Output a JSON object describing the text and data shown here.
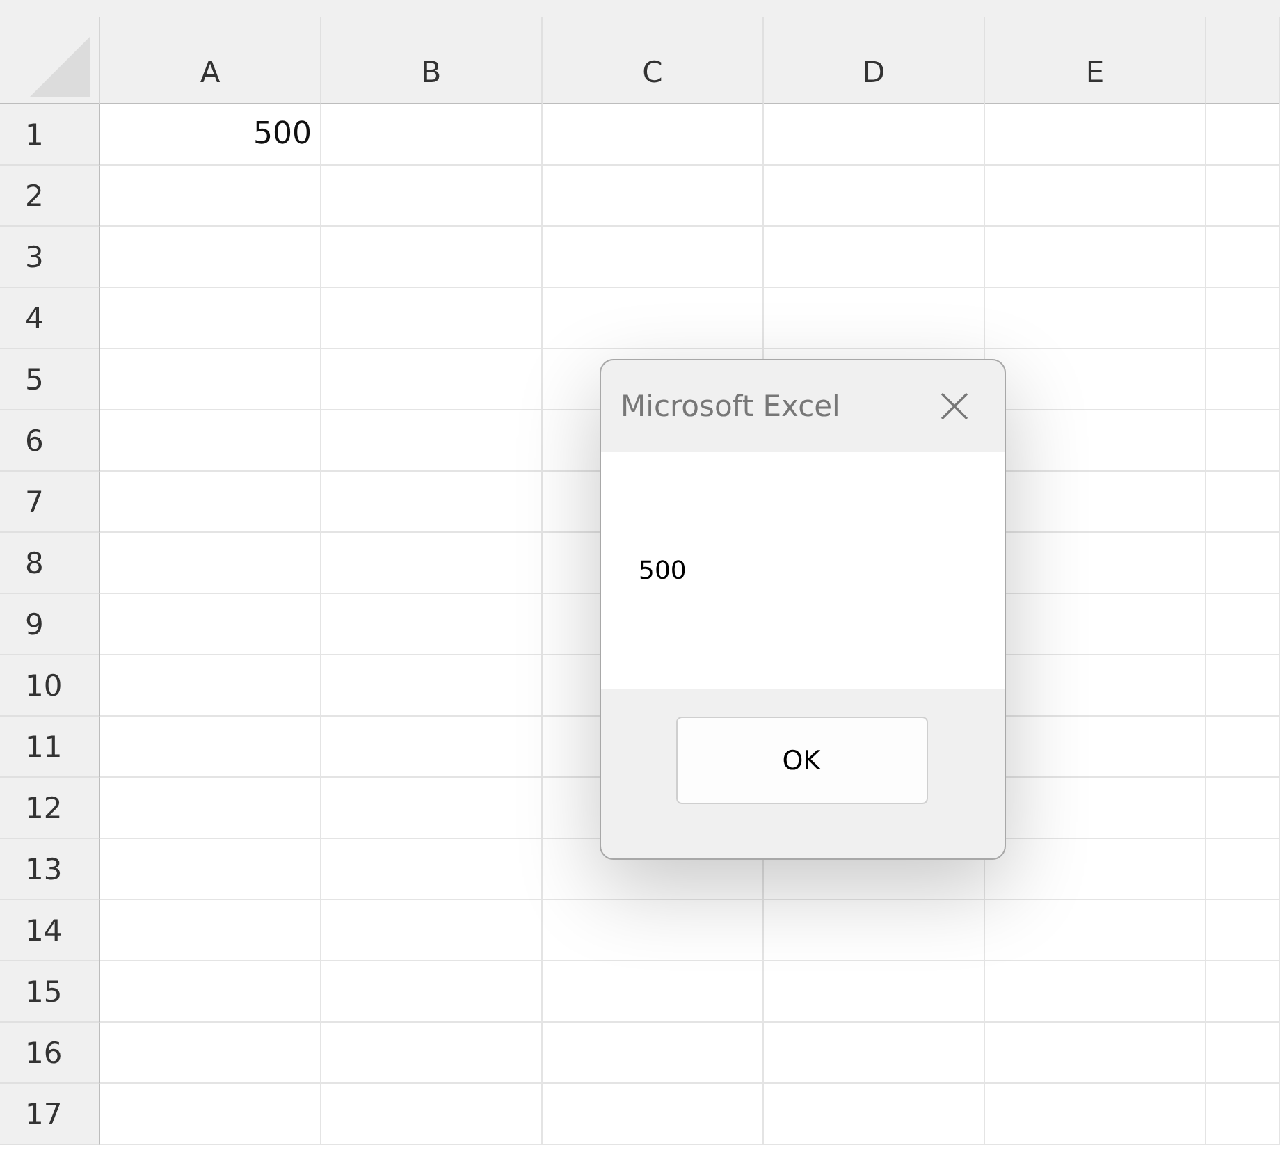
{
  "sheet": {
    "columns": [
      "A",
      "B",
      "C",
      "D",
      "E"
    ],
    "rows": [
      {
        "number": "1",
        "cells": [
          "500"
        ]
      },
      {
        "number": "2",
        "cells": []
      },
      {
        "number": "3",
        "cells": []
      },
      {
        "number": "4",
        "cells": []
      },
      {
        "number": "5",
        "cells": []
      },
      {
        "number": "6",
        "cells": []
      },
      {
        "number": "7",
        "cells": []
      },
      {
        "number": "8",
        "cells": []
      },
      {
        "number": "9",
        "cells": []
      },
      {
        "number": "10",
        "cells": []
      },
      {
        "number": "11",
        "cells": []
      },
      {
        "number": "12",
        "cells": []
      },
      {
        "number": "13",
        "cells": []
      },
      {
        "number": "14",
        "cells": []
      },
      {
        "number": "15",
        "cells": []
      },
      {
        "number": "16",
        "cells": []
      },
      {
        "number": "17",
        "cells": []
      }
    ]
  },
  "dialog": {
    "title": "Microsoft Excel",
    "message": "500",
    "button": "OK"
  }
}
